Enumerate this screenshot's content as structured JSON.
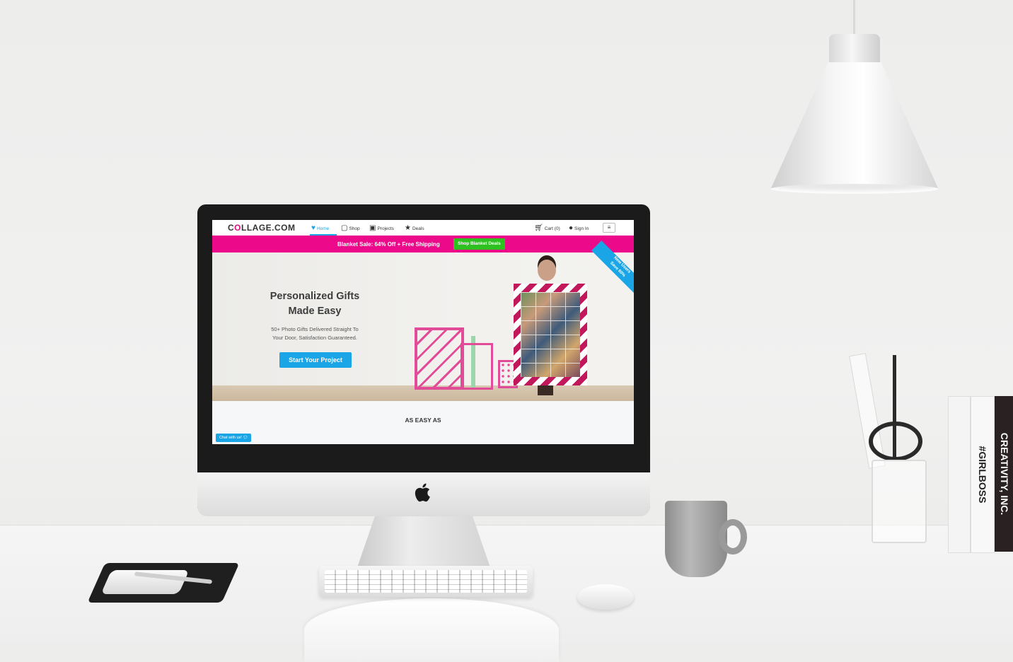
{
  "site": {
    "logo": {
      "prefix": "C",
      "highlight": "O",
      "rest": "LLAGE.COM"
    },
    "nav": [
      {
        "label": "Home",
        "icon": "heart-icon",
        "active": true
      },
      {
        "label": "Shop",
        "icon": "shop-icon",
        "active": false
      },
      {
        "label": "Projects",
        "icon": "projects-icon",
        "active": false
      },
      {
        "label": "Deals",
        "icon": "star-icon",
        "active": false
      }
    ],
    "cart_label": "Cart (0)",
    "signin_label": "Sign In",
    "menu_icon": "hamburger-icon"
  },
  "promo": {
    "text": "Blanket Sale: 64% Off + Free Shipping",
    "button": "Shop Blanket Deals"
  },
  "hero": {
    "title_line1": "Personalized Gifts",
    "title_line2": "Made Easy",
    "subtitle_line1": "50+ Photo Gifts Delivered Straight To",
    "subtitle_line2": "Your Door, Satisfaction Guaranteed.",
    "cta": "Start Your Project",
    "badge_line1": "New Users",
    "badge_line2": "Save 60%"
  },
  "section": {
    "title": "AS EASY AS"
  },
  "chat": {
    "label": "Chat with us!"
  },
  "books": [
    "CREATIVITY, INC.",
    "#GIRLBOSS"
  ],
  "colors": {
    "brand_pink": "#ec0a8b",
    "brand_blue": "#1aa5e6",
    "promo_button_green": "#2cc11f"
  }
}
